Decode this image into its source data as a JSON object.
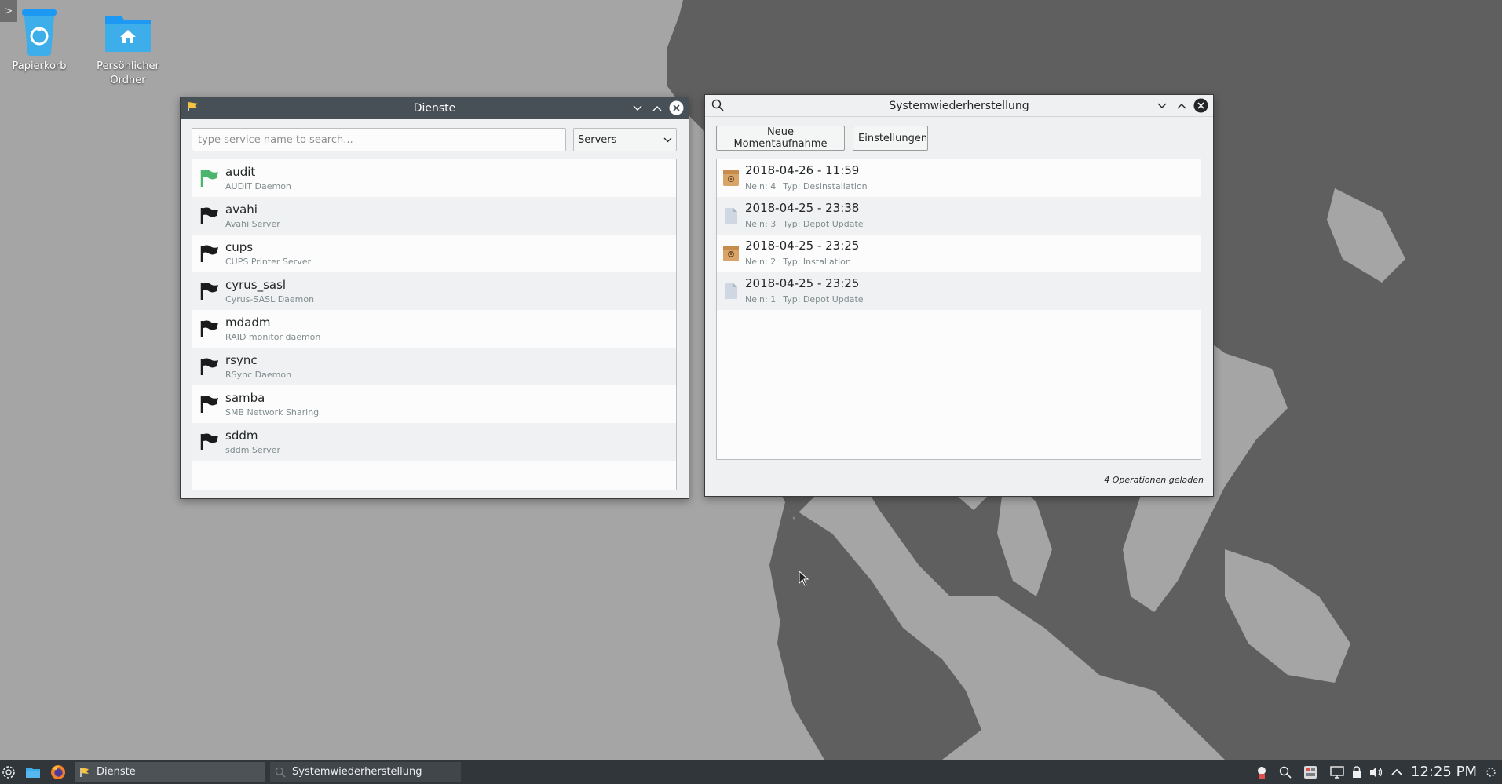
{
  "desktop": {
    "icons": [
      {
        "label": "Papierkorb"
      },
      {
        "label": "Persönlicher Ordner"
      }
    ],
    "colors": {
      "wallpaper_light": "#a5a5a5",
      "wallpaper_dark": "#5f5f5f"
    }
  },
  "dienste": {
    "title": "Dienste",
    "search_placeholder": "type service name to search...",
    "filter_selected": "Servers",
    "services": [
      {
        "name": "audit",
        "desc": "AUDIT Daemon",
        "running": true
      },
      {
        "name": "avahi",
        "desc": "Avahi Server",
        "running": false
      },
      {
        "name": "cups",
        "desc": "CUPS Printer Server",
        "running": false
      },
      {
        "name": "cyrus_sasl",
        "desc": "Cyrus-SASL Daemon",
        "running": false
      },
      {
        "name": "mdadm",
        "desc": "RAID monitor daemon",
        "running": false
      },
      {
        "name": "rsync",
        "desc": "RSync Daemon",
        "running": false
      },
      {
        "name": "samba",
        "desc": "SMB Network Sharing",
        "running": false
      },
      {
        "name": "sddm",
        "desc": "sddm Server",
        "running": false
      }
    ],
    "colors": {
      "running_flag": "#3daee9",
      "running_flag_green": "#4cb56d",
      "stopped_flag": "#1b1b1b"
    }
  },
  "snapper": {
    "title": "Systemwiederherstellung",
    "new_snapshot_label": "Neue Momentaufnahme",
    "settings_label": "Einstellungen",
    "snapshots": [
      {
        "date": "2018-04-26 - 11:59",
        "nr": "Nein: 4",
        "type": "Typ: Desinstallation",
        "icon": "package-icon"
      },
      {
        "date": "2018-04-25 - 23:38",
        "nr": "Nein: 3",
        "type": "Typ: Depot Update",
        "icon": "document-icon"
      },
      {
        "date": "2018-04-25 - 23:25",
        "nr": "Nein: 2",
        "type": "Typ: Installation",
        "icon": "package-icon"
      },
      {
        "date": "2018-04-25 - 23:25",
        "nr": "Nein: 1",
        "type": "Typ: Depot Update",
        "icon": "document-icon"
      }
    ],
    "status": "4 Operationen geladen"
  },
  "taskbar": {
    "tasks": [
      {
        "label": "Dienste"
      },
      {
        "label": "Systemwiederherstellung"
      }
    ],
    "clock": "12:25 PM"
  }
}
